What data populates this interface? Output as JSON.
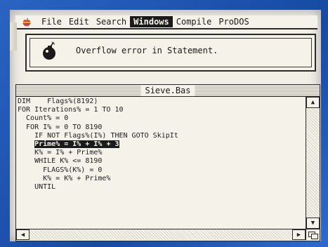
{
  "menubar": {
    "items": [
      {
        "label": "File"
      },
      {
        "label": "Edit"
      },
      {
        "label": "Search"
      },
      {
        "label": "Windows",
        "active": true
      },
      {
        "label": "Compile"
      },
      {
        "label": "ProDOS"
      }
    ]
  },
  "alert": {
    "message": "Overflow error in Statement.",
    "icon": "bomb-icon"
  },
  "window": {
    "title": "Sieve.Bas",
    "lines": [
      "DIM    Flags%(8192)",
      "FOR Iterations% = 1 TO 10",
      "  Count% = 0",
      "  FOR I% = 0 TO 8190",
      "    IF NOT Flags%(I%) THEN GOTO SkipIt",
      "    Prime% = I% + I% + 3",
      "    K% = I% + Prime%",
      "    WHILE K% <= 8190",
      "      FLAGS%(K%) = 0",
      "      K% = K% + Prime%",
      "    UNTIL"
    ],
    "highlight_line": 5,
    "highlight_text": "Prime% = I% + I% + 3"
  },
  "colors": {
    "screen_bg": "#f2f0e6",
    "ink": "#1b1b1b",
    "bezel": "#1f56b4"
  }
}
